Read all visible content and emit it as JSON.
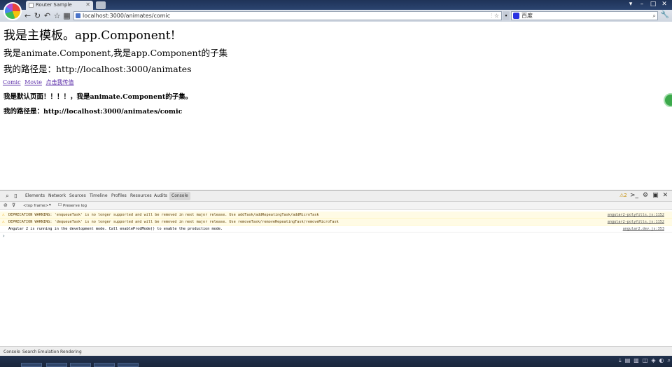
{
  "browser": {
    "tab_title": "Router Sample",
    "url": "localhost:3000/animates/comic",
    "search_engine": "百度",
    "icons": [
      "app-logo-icon",
      "back-icon",
      "forward-icon",
      "home-icon",
      "bookmark-star-icon",
      "apps-icon",
      "search-icon",
      "tools-icon"
    ]
  },
  "page": {
    "heading": "我是主模板。app.Component!",
    "sub1": "我是animate.Component,我是app.Component的子集",
    "sub2": "我的路径是：http://localhost:3000/animates",
    "links": [
      "Comic",
      "Movie",
      "点击我传值"
    ],
    "default_text": "我是默认页面！！！！，我是animate.Component的子集。",
    "path_text": "我的路径是：http://localhost:3000/animates/comic"
  },
  "devtools": {
    "tabs": [
      "Elements",
      "Network",
      "Sources",
      "Timeline",
      "Profiles",
      "Resources",
      "Audits",
      "Console"
    ],
    "active_tab": "Console",
    "warning_count": "2",
    "frame": "<top frame>",
    "preserve_log": "Preserve log",
    "messages": [
      {
        "level": "warning",
        "text": "DEPRECATION WARNING: 'enqueueTask' is no longer supported and will be removed in next major release. Use addTask/addRepeatingTask/addMicroTask",
        "source": "angular2-polyfills.js:1152"
      },
      {
        "level": "warning",
        "text": "DEPRECATION WARNING: 'dequeueTask' is no longer supported and will be removed in next major release. Use removeTask/removeRepeatingTask/removeMicroTask",
        "source": "angular2-polyfills.js:1152"
      },
      {
        "level": "info",
        "text": "Angular 2 is running in the development mode. Call enableProdMode() to enable the production mode.",
        "source": "angular2.dev.js:353"
      }
    ],
    "drawer_tabs": [
      "Console",
      "Search",
      "Emulation",
      "Rendering"
    ]
  }
}
